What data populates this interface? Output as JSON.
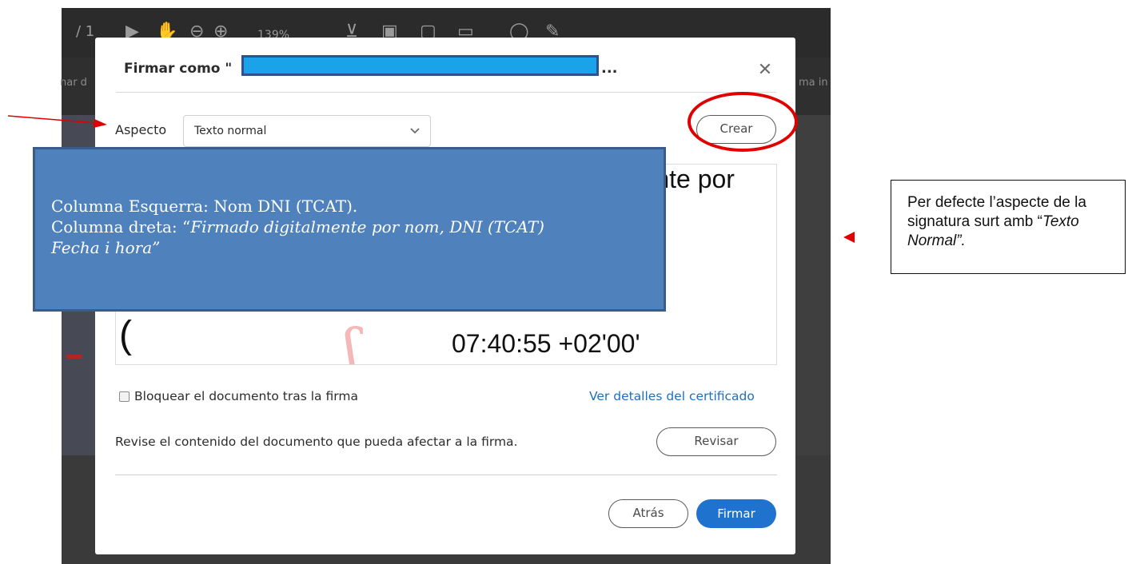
{
  "app": {
    "page_indicator": "/ 1",
    "zoom": "139%",
    "left_side_text": "nar d",
    "right_side_text": "ma in"
  },
  "dialog": {
    "title": "Firmar como \"",
    "title_ellipsis": "...",
    "close_icon": "close-icon",
    "aspect_label": "Aspecto",
    "aspect_value": "Texto normal",
    "create_button": "Crear",
    "preview": {
      "fragment_top": "Firmado digitalmente por",
      "fragment_bottom": "07:40:55 +02'00'",
      "overlay_line1": "Columna Esquerra: Nom DNI (TCAT).",
      "overlay_line2_prefix": "Columna dreta: “",
      "overlay_line2_italic": "Firmado digitalmente por nom, DNI (TCAT)",
      "overlay_line3_italic": "Fecha i hora”"
    },
    "lock_checkbox_label": "Bloquear el documento tras la firma",
    "certificate_link": "Ver detalles del certificado",
    "review_text": "Revise el contenido del documento que pueda afectar a la firma.",
    "review_button": "Revisar",
    "back_button": "Atrás",
    "sign_button": "Firmar"
  },
  "annotation": {
    "note_line1": "Per defecte l’aspecte de la signatura surt amb “",
    "note_italic": "Texto Normal”.",
    "highlight_color": "#e00000",
    "overlay_color": "#4f81bd"
  }
}
